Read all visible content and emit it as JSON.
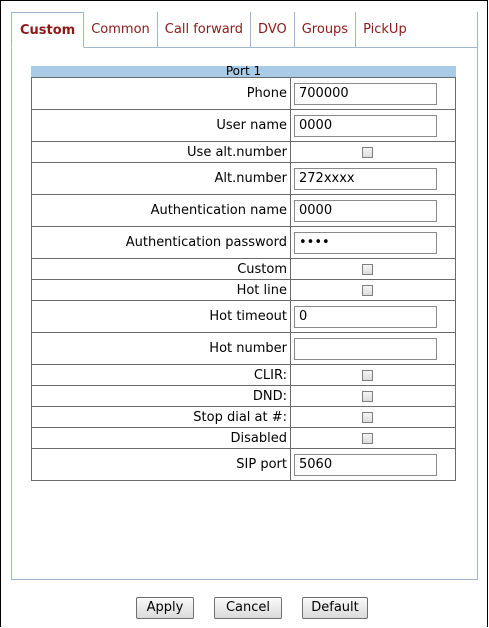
{
  "tabs": [
    {
      "label": "Custom",
      "active": true
    },
    {
      "label": "Common",
      "active": false
    },
    {
      "label": "Call forward",
      "active": false
    },
    {
      "label": "DVO",
      "active": false
    },
    {
      "label": "Groups",
      "active": false
    },
    {
      "label": "PickUp",
      "active": false
    }
  ],
  "port_header": "Port 1",
  "fields": {
    "phone": {
      "label": "Phone",
      "value": "700000"
    },
    "user_name": {
      "label": "User name",
      "value": "0000"
    },
    "use_alt_number": {
      "label": "Use alt.number",
      "checked": false
    },
    "alt_number": {
      "label": "Alt.number",
      "value": "272xxxx"
    },
    "auth_name": {
      "label": "Authentication name",
      "value": "0000"
    },
    "auth_password": {
      "label": "Authentication password",
      "value": "••••"
    },
    "custom": {
      "label": "Custom",
      "checked": false
    },
    "hot_line": {
      "label": "Hot line",
      "checked": false
    },
    "hot_timeout": {
      "label": "Hot timeout",
      "value": "0"
    },
    "hot_number": {
      "label": "Hot number",
      "value": ""
    },
    "clir": {
      "label": "CLIR:",
      "checked": false
    },
    "dnd": {
      "label": "DND:",
      "checked": false
    },
    "stop_dial": {
      "label": "Stop dial at #:",
      "checked": false
    },
    "disabled": {
      "label": "Disabled",
      "checked": false
    },
    "sip_port": {
      "label": "SIP port",
      "value": "5060"
    }
  },
  "buttons": {
    "apply": "Apply",
    "cancel": "Cancel",
    "default": "Default"
  },
  "colors": {
    "tab_text": "#8b1a1a",
    "header_bg": "#a8cce8",
    "border": "#9fb8d2"
  }
}
